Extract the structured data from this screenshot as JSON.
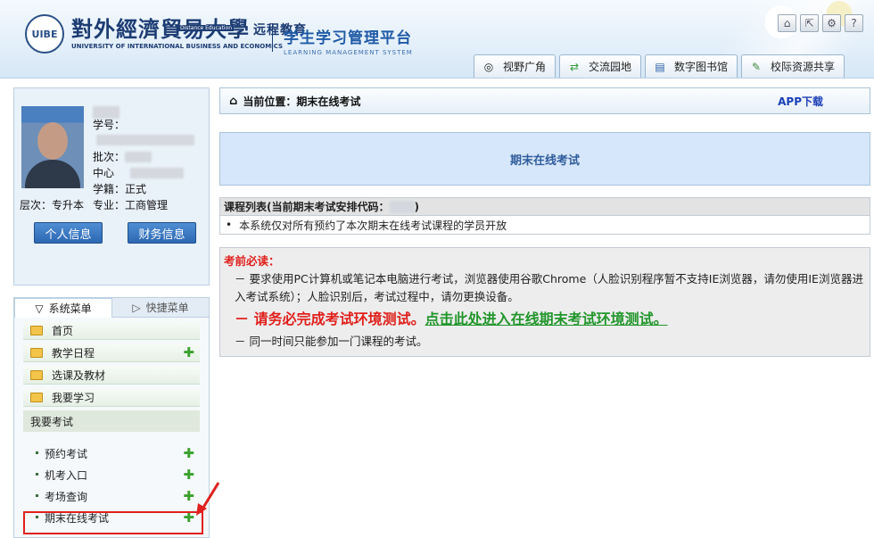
{
  "header": {
    "logo_cn": "對外經濟貿易大學",
    "logo_cn_suffix": "远程教育",
    "logo_sub": "Distance Education",
    "logo_en": "UNIVERSITY OF INTERNATIONAL BUSINESS AND ECONOMICS",
    "emblem_text": "UIBE",
    "platform_cn": "学生学习管理平台",
    "platform_en": "LEARNING MANAGEMENT SYSTEM",
    "tabs": [
      {
        "label": "视野广角",
        "icon": "camera-icon"
      },
      {
        "label": "交流园地",
        "icon": "exchange-icon"
      },
      {
        "label": "数字图书馆",
        "icon": "library-icon"
      },
      {
        "label": "校际资源共享",
        "icon": "share-icon"
      }
    ],
    "tool_icons": [
      "home-icon",
      "export-icon",
      "gear-icon",
      "help-icon"
    ]
  },
  "profile": {
    "student_id_label": "学号：",
    "batch_label": "批次：",
    "center_label": "中心",
    "status_label": "学籍：",
    "status_value": "正式",
    "level_label": "层次：",
    "level_value": "专升本",
    "major_label": "专业：",
    "major_value": "工商管理",
    "personal_info_btn": "个人信息",
    "finance_info_btn": "财务信息"
  },
  "menu": {
    "tab_system": "系统菜单",
    "tab_shortcut": "快捷菜单",
    "items": [
      {
        "label": "首页",
        "plus": false
      },
      {
        "label": "教学日程",
        "plus": true
      },
      {
        "label": "选课及教材",
        "plus": false
      },
      {
        "label": "我要学习",
        "plus": false
      }
    ],
    "group": "我要考试",
    "sub_items": [
      "预约考试",
      "机考入口",
      "考场查询",
      "期末在线考试"
    ]
  },
  "main": {
    "breadcrumb": "当前位置：期末在线考试",
    "app_download": "APP下载",
    "banner_title": "期末在线考试",
    "course_header": "课程列表(当前期末考试安排代码：",
    "course_header_end": ")",
    "course_note": "本系统仅对所有预约了本次期末在线考试课程的学员开放",
    "notice_title": "考前必读：",
    "notice_line1": "－ 要求使用PC计算机或笔记本电脑进行考试，浏览器使用谷歌Chrome（人脸识别程序暂不支持IE浏览器，请勿使用IE浏览器进入考试系统）；人脸识别后，考试过程中，请勿更换设备。",
    "notice_big_prefix": "－ ",
    "notice_big_red": "请务必完成考试环境测试。",
    "notice_big_green": "点击此处进入在线期末考试环境测试。",
    "notice_line3": "－ 同一时间只能参加一门课程的考试。"
  }
}
